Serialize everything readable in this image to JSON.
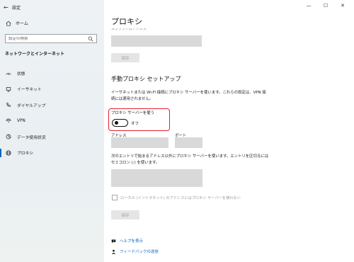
{
  "window": {
    "app_title": "設定",
    "controls": {
      "minimize": "—",
      "maximize": "☐",
      "close": "✕"
    }
  },
  "sidebar": {
    "back_icon": "back-arrow-icon",
    "home_label": "ホーム",
    "search": {
      "placeholder": "設定の検索",
      "value": ""
    },
    "section_title": "ネットワークとインターネット",
    "items": [
      {
        "label": "状態",
        "icon": "status-icon"
      },
      {
        "label": "イーサネット",
        "icon": "ethernet-icon"
      },
      {
        "label": "ダイヤルアップ",
        "icon": "dialup-icon"
      },
      {
        "label": "VPN",
        "icon": "vpn-icon"
      },
      {
        "label": "データ使用状況",
        "icon": "data-usage-icon"
      },
      {
        "label": "プロキシ",
        "icon": "proxy-icon",
        "active": true
      }
    ]
  },
  "main": {
    "page_title": "プロキシ",
    "cut_label": "スクリプトのアドレス",
    "save_label_top": "保存",
    "manual_heading": "手動プロキシ セットアップ",
    "description": "イーサネットまたは Wi-Fi 接続にプロキシ サーバーを使います。これらの設定は、VPN 接続には適用されません。",
    "use_proxy_label": "プロキシ サーバーを使う",
    "use_proxy_state": "オフ",
    "use_proxy_on": false,
    "address_label": "アドレス",
    "port_label": "ポート",
    "exceptions_desc": "次のエントリで始まるアドレス以外にプロキシ サーバーを使います。エントリを区切るにはセミコロン (;) を使います。",
    "local_checkbox_label": "ローカル (イントラネット) のアドレスにはプロキシ サーバーを使わない",
    "save_label_bottom": "保存",
    "help_link": "ヘルプを表示",
    "feedback_link": "フィードバックの送信"
  },
  "colors": {
    "accent": "#0067c0",
    "highlight_box": "#e8202e",
    "sidebar_bg": "#eaf0f3"
  }
}
